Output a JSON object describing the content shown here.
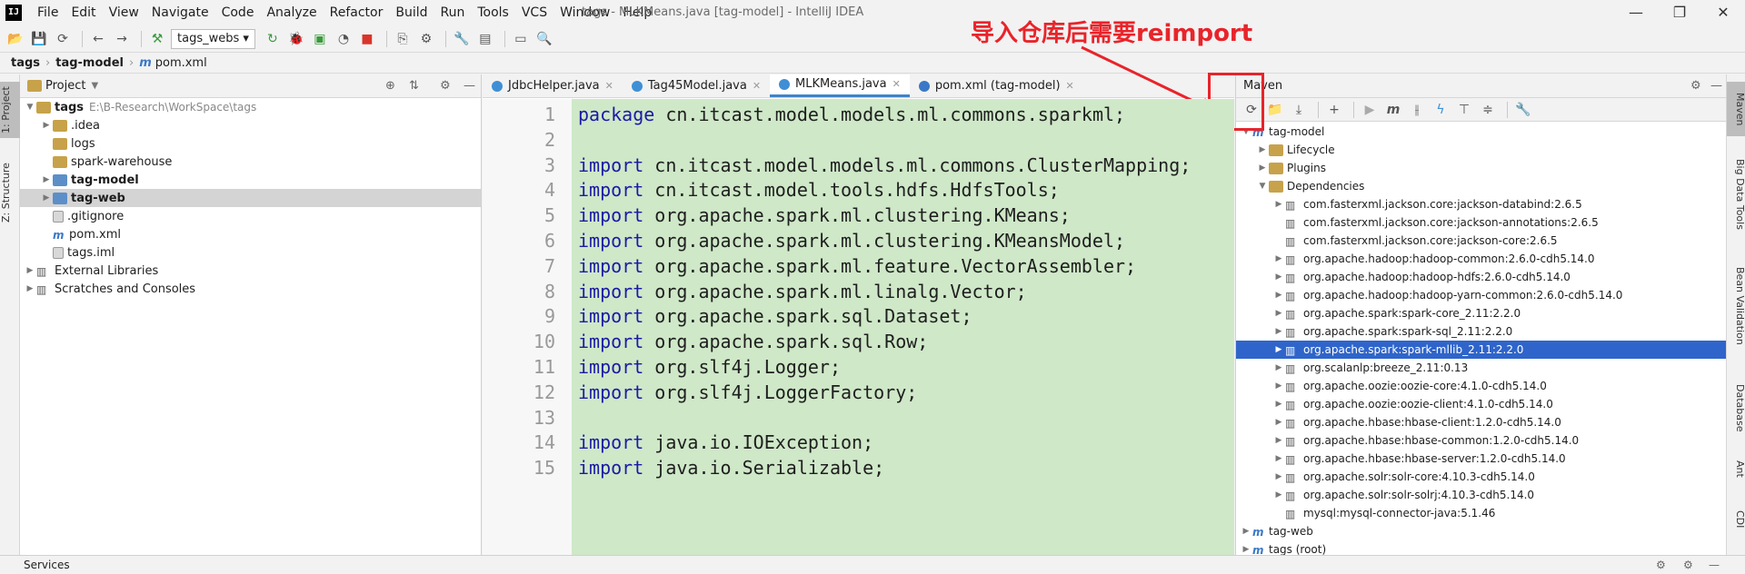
{
  "window": {
    "title": "tags - MLKMeans.java [tag-model] - IntelliJ IDEA",
    "logo": "IJ",
    "menu": [
      "File",
      "Edit",
      "View",
      "Navigate",
      "Code",
      "Analyze",
      "Refactor",
      "Build",
      "Run",
      "Tools",
      "VCS",
      "Window",
      "Help"
    ],
    "controls": [
      "—",
      "❐",
      "✕"
    ]
  },
  "toolbar": {
    "run_config": "tags_webs"
  },
  "breadcrumb": [
    "tags",
    "tag-model",
    "pom.xml"
  ],
  "left_strip": {
    "project_tab": "1: Project",
    "structure_tab": "Z: Structure"
  },
  "project": {
    "title": "Project",
    "tree": [
      {
        "label": "tags",
        "path": "E:\\B-Research\\WorkSpace\\tags",
        "indent": 0,
        "arrow": "▼",
        "icon": "folder",
        "bold": true
      },
      {
        "label": ".idea",
        "indent": 1,
        "arrow": "▶",
        "icon": "folder"
      },
      {
        "label": "logs",
        "indent": 1,
        "arrow": "",
        "icon": "folder"
      },
      {
        "label": "spark-warehouse",
        "indent": 1,
        "arrow": "",
        "icon": "folder"
      },
      {
        "label": "tag-model",
        "indent": 1,
        "arrow": "▶",
        "icon": "folder-blue",
        "bold": true
      },
      {
        "label": "tag-web",
        "indent": 1,
        "arrow": "▶",
        "icon": "folder-blue",
        "bold": true,
        "selected": true
      },
      {
        "label": ".gitignore",
        "indent": 1,
        "arrow": "",
        "icon": "file"
      },
      {
        "label": "pom.xml",
        "indent": 1,
        "arrow": "",
        "icon": "maven"
      },
      {
        "label": "tags.iml",
        "indent": 1,
        "arrow": "",
        "icon": "file"
      },
      {
        "label": "External Libraries",
        "indent": 0,
        "arrow": "▶",
        "icon": "lib"
      },
      {
        "label": "Scratches and Consoles",
        "indent": 0,
        "arrow": "▶",
        "icon": "lib"
      }
    ]
  },
  "editor": {
    "tabs": [
      {
        "label": "JdbcHelper.java",
        "color": "#3f8fd6"
      },
      {
        "label": "Tag45Model.java",
        "color": "#3f8fd6"
      },
      {
        "label": "MLKMeans.java",
        "color": "#3f8fd6",
        "active": true
      },
      {
        "label": "pom.xml (tag-model)",
        "color": "#3b78c8"
      }
    ],
    "current_line": 4,
    "lines": [
      {
        "n": "1",
        "kw": "package",
        "rest": " cn.itcast.model.models.ml.commons.sparkml;"
      },
      {
        "n": "2",
        "kw": "",
        "rest": ""
      },
      {
        "n": "3",
        "kw": "import",
        "rest": " cn.itcast.model.models.ml.commons.ClusterMapping;"
      },
      {
        "n": "4",
        "kw": "import",
        "rest": " cn.itcast.model.tools.hdfs.HdfsTools;"
      },
      {
        "n": "5",
        "kw": "import",
        "rest": " org.apache.spark.ml.clustering.KMeans;"
      },
      {
        "n": "6",
        "kw": "import",
        "rest": " org.apache.spark.ml.clustering.KMeansModel;"
      },
      {
        "n": "7",
        "kw": "import",
        "rest": " org.apache.spark.ml.feature.VectorAssembler;"
      },
      {
        "n": "8",
        "kw": "import",
        "rest": " org.apache.spark.ml.linalg.Vector;"
      },
      {
        "n": "9",
        "kw": "import",
        "rest": " org.apache.spark.sql.Dataset;"
      },
      {
        "n": "10",
        "kw": "import",
        "rest": " org.apache.spark.sql.Row;"
      },
      {
        "n": "11",
        "kw": "import",
        "rest": " org.slf4j.Logger;"
      },
      {
        "n": "12",
        "kw": "import",
        "rest": " org.slf4j.LoggerFactory;"
      },
      {
        "n": "13",
        "kw": "",
        "rest": ""
      },
      {
        "n": "14",
        "kw": "import",
        "rest": " java.io.IOException;"
      },
      {
        "n": "15",
        "kw": "import",
        "rest": " java.io.Serializable;"
      }
    ]
  },
  "maven": {
    "title": "Maven",
    "tree": [
      {
        "label": "tag-model",
        "indent": 0,
        "arrow": "▼"
      },
      {
        "label": "Lifecycle",
        "indent": 1,
        "arrow": "▶",
        "folder": true
      },
      {
        "label": "Plugins",
        "indent": 1,
        "arrow": "▶",
        "folder": true
      },
      {
        "label": "Dependencies",
        "indent": 1,
        "arrow": "▼",
        "folder": true
      },
      {
        "label": "com.fasterxml.jackson.core:jackson-databind:2.6.5",
        "indent": 2,
        "arrow": "▶"
      },
      {
        "label": "com.fasterxml.jackson.core:jackson-annotations:2.6.5",
        "indent": 2,
        "arrow": ""
      },
      {
        "label": "com.fasterxml.jackson.core:jackson-core:2.6.5",
        "indent": 2,
        "arrow": ""
      },
      {
        "label": "org.apache.hadoop:hadoop-common:2.6.0-cdh5.14.0",
        "indent": 2,
        "arrow": "▶"
      },
      {
        "label": "org.apache.hadoop:hadoop-hdfs:2.6.0-cdh5.14.0",
        "indent": 2,
        "arrow": "▶"
      },
      {
        "label": "org.apache.hadoop:hadoop-yarn-common:2.6.0-cdh5.14.0",
        "indent": 2,
        "arrow": "▶"
      },
      {
        "label": "org.apache.spark:spark-core_2.11:2.2.0",
        "indent": 2,
        "arrow": "▶"
      },
      {
        "label": "org.apache.spark:spark-sql_2.11:2.2.0",
        "indent": 2,
        "arrow": "▶"
      },
      {
        "label": "org.apache.spark:spark-mllib_2.11:2.2.0",
        "indent": 2,
        "arrow": "▶",
        "selected": true
      },
      {
        "label": "org.scalanlp:breeze_2.11:0.13",
        "indent": 2,
        "arrow": "▶"
      },
      {
        "label": "org.apache.oozie:oozie-core:4.1.0-cdh5.14.0",
        "indent": 2,
        "arrow": "▶"
      },
      {
        "label": "org.apache.oozie:oozie-client:4.1.0-cdh5.14.0",
        "indent": 2,
        "arrow": "▶"
      },
      {
        "label": "org.apache.hbase:hbase-client:1.2.0-cdh5.14.0",
        "indent": 2,
        "arrow": "▶"
      },
      {
        "label": "org.apache.hbase:hbase-common:1.2.0-cdh5.14.0",
        "indent": 2,
        "arrow": "▶"
      },
      {
        "label": "org.apache.hbase:hbase-server:1.2.0-cdh5.14.0",
        "indent": 2,
        "arrow": "▶"
      },
      {
        "label": "org.apache.solr:solr-core:4.10.3-cdh5.14.0",
        "indent": 2,
        "arrow": "▶"
      },
      {
        "label": "org.apache.solr:solr-solrj:4.10.3-cdh5.14.0",
        "indent": 2,
        "arrow": "▶"
      },
      {
        "label": "mysql:mysql-connector-java:5.1.46",
        "indent": 2,
        "arrow": ""
      },
      {
        "label": "tag-web",
        "indent": 0,
        "arrow": "▶"
      },
      {
        "label": "tags (root)",
        "indent": 0,
        "arrow": "▶"
      }
    ]
  },
  "right_strip": [
    "Maven",
    "Big Data Tools",
    "Bean Validation",
    "Database",
    "Ant",
    "CDI"
  ],
  "bottom": {
    "services": "Services"
  },
  "annotation": {
    "text": "导入仓库后需要reimport",
    "color": "#e8242a"
  }
}
